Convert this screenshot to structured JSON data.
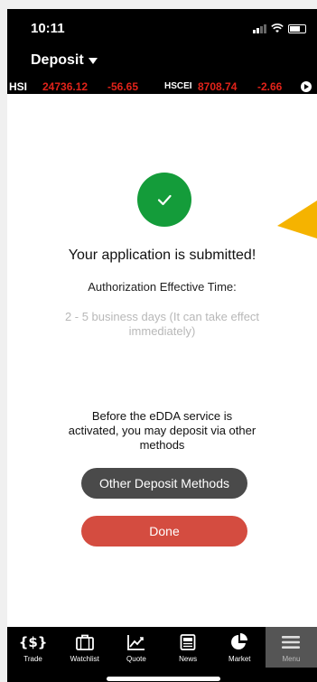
{
  "status_bar": {
    "time": "10:11"
  },
  "header": {
    "title": "Deposit"
  },
  "ticker": {
    "hsi_label": "HSI",
    "hsi_value": "24736.12",
    "hsi_change": "-56.65",
    "hscei_label": "HSCEI",
    "hscei_value": "8708.74",
    "hscei_change": "-2.66"
  },
  "main": {
    "heading": "Your application is submitted!",
    "auth_label": "Authorization Effective Time:",
    "auth_value": "2 - 5 business days (It can take effect immediately)",
    "before_text": "Before the eDDA service is activated, you may deposit via other methods",
    "other_button": "Other Deposit Methods",
    "done_button": "Done"
  },
  "colors": {
    "success": "#149c3a",
    "done": "#d44c40",
    "ticker_negative": "#e2231a",
    "annotation_arrow": "#f5b300"
  },
  "tabs": [
    {
      "label": "Trade",
      "icon": "dollar-icon"
    },
    {
      "label": "Watchlist",
      "icon": "briefcase-icon"
    },
    {
      "label": "Quote",
      "icon": "line-chart-icon"
    },
    {
      "label": "News",
      "icon": "newspaper-icon"
    },
    {
      "label": "Market",
      "icon": "pie-chart-icon"
    },
    {
      "label": "Menu",
      "icon": "hamburger-icon",
      "active": true
    }
  ]
}
